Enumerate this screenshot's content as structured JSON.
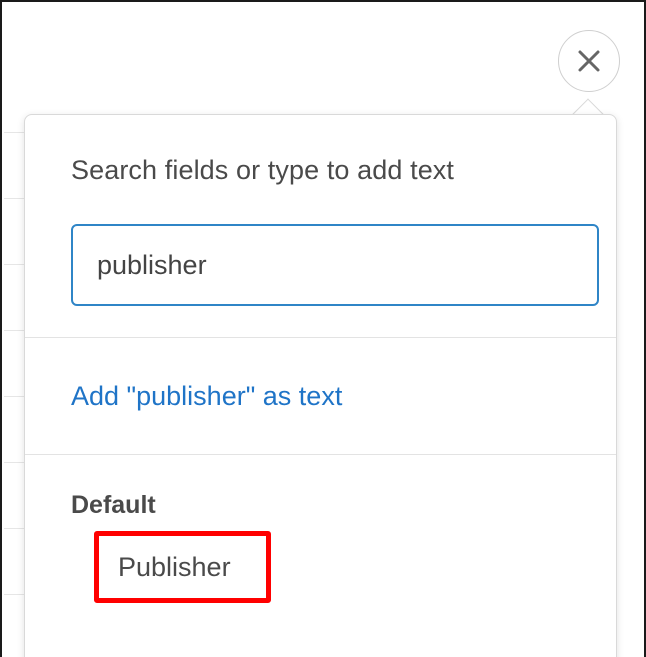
{
  "popover": {
    "prompt": "Search fields or type to add text",
    "search": {
      "value": "publisher"
    },
    "add_text_link": "Add \"publisher\" as text",
    "section": {
      "label": "Default",
      "options": [
        {
          "label": "Publisher"
        }
      ]
    }
  },
  "icons": {
    "close": "close-icon"
  },
  "colors": {
    "accent": "#2f85c7",
    "link": "#1f74c7",
    "highlight": "#ff0000"
  }
}
